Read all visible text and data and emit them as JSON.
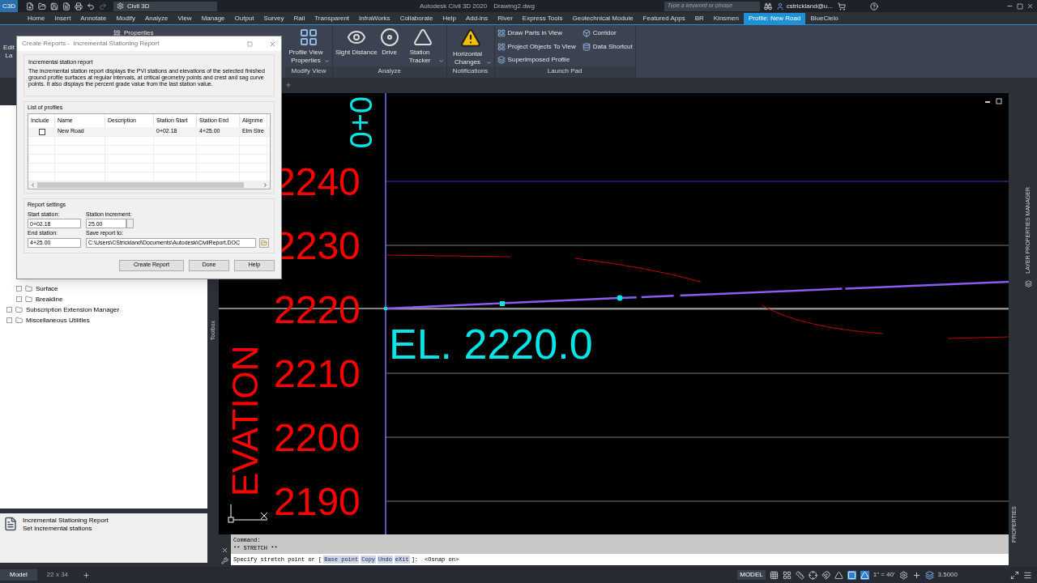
{
  "title_bar": {
    "logo_caption": "C3D",
    "workspace": "Civil 3D",
    "app_title": "Autodesk Civil 3D 2020",
    "file_name": "Drawing2.dwg",
    "search": {
      "placeholder": "Type a keyword or phrase"
    },
    "user": "cstrickland@u..."
  },
  "ribbon_tabs": [
    {
      "label": "Home",
      "selected": false
    },
    {
      "label": "Insert",
      "selected": false
    },
    {
      "label": "Annotate",
      "selected": false
    },
    {
      "label": "Modify",
      "selected": false
    },
    {
      "label": "Analyze",
      "selected": false
    },
    {
      "label": "View",
      "selected": false
    },
    {
      "label": "Manage",
      "selected": false
    },
    {
      "label": "Output",
      "selected": false
    },
    {
      "label": "Survey",
      "selected": false
    },
    {
      "label": "Rail",
      "selected": false
    },
    {
      "label": "Transparent",
      "selected": false
    },
    {
      "label": "InfraWorks",
      "selected": false
    },
    {
      "label": "Collaborate",
      "selected": false
    },
    {
      "label": "Help",
      "selected": false
    },
    {
      "label": "Add-ins",
      "selected": false
    },
    {
      "label": "River",
      "selected": false
    },
    {
      "label": "Express Tools",
      "selected": false
    },
    {
      "label": "Geotechnical Module",
      "selected": false
    },
    {
      "label": "Featured Apps",
      "selected": false
    },
    {
      "label": "BR",
      "selected": false
    },
    {
      "label": "Kinsmen",
      "selected": false
    },
    {
      "label": "Profile: New Road",
      "selected": true
    },
    {
      "label": "BlueCielo",
      "selected": false
    }
  ],
  "ribbon": {
    "partial_button": [
      "Edit",
      "La"
    ],
    "partial_small_button": "Properties",
    "groups": [
      {
        "title": "Modify View",
        "kind": "large",
        "buttons": [
          {
            "label": "Profile View Properties",
            "dropdown": true
          }
        ]
      },
      {
        "title": "Analyze",
        "kind": "large",
        "buttons": [
          {
            "label": "Sight Distance",
            "dropdown": false
          },
          {
            "label": "Drive",
            "dropdown": false
          },
          {
            "label": "Station Tracker",
            "dropdown": true
          }
        ]
      },
      {
        "title": "Notifications",
        "kind": "large",
        "buttons": [
          {
            "label": "Horizontal Changes",
            "dropdown": true
          }
        ]
      },
      {
        "title": "Launch Pad",
        "kind": "small",
        "buttons": [
          {
            "label": "Draw Parts in View"
          },
          {
            "label": "Project Objects To View"
          },
          {
            "label": "Superimposed Profile"
          },
          {
            "label": "Corridor"
          },
          {
            "label": "Data Shortcut"
          }
        ]
      }
    ]
  },
  "dialog": {
    "title": "Create Reports -  Incremental Stationing Report",
    "report_group": {
      "title": "Incremental station report",
      "description": "The incremental station report displays the PVI stations and elevations of the selected finished ground profile surfaces at regular intervals, at critical geometry points and crest and sag curve points. It also displays the percent grade value from the last station value."
    },
    "profiles": {
      "title": "List of profiles",
      "columns": [
        "Include",
        "Name",
        "Description",
        "Station Start",
        "Station End",
        "Alignme"
      ],
      "rows": [
        {
          "include": false,
          "name": "New Road",
          "description": "",
          "station_start": "0+02.18",
          "station_end": "4+25.00",
          "alignment": "Elm Stre"
        }
      ]
    },
    "settings": {
      "title": "Report settings",
      "start_station": {
        "label": "Start station:",
        "value": "0+02.18"
      },
      "station_increment": {
        "label": "Station increment:",
        "value": "25.00"
      },
      "end_station": {
        "label": "End station:",
        "value": "4+25.00"
      },
      "save_to": {
        "label": "Save report to:",
        "value": "C:\\Users\\CStrickland\\Documents\\Autodesk\\CivilReport.DOC"
      }
    },
    "buttons": [
      "Create Report",
      "Done",
      "Help"
    ]
  },
  "toolspace": {
    "tree": [
      {
        "children": [
          {
            "label": "Surface"
          },
          {
            "label": "Breakline"
          }
        ]
      },
      {
        "label": "Subscription Extension Manager"
      },
      {
        "label": "Miscellaneous Utilities"
      }
    ],
    "info": {
      "title": "Incremental Stationing Report",
      "subtitle": "Set incremental stations"
    },
    "side_tab": "Toolbox"
  },
  "canvas": {
    "elevation_labels": [
      "2240",
      "2230",
      "2220",
      "2210",
      "2200",
      "2190"
    ],
    "axis_title": "EVATION",
    "station_label": "0+0",
    "elevation_callout": "EL. 2220.0"
  },
  "command_line": {
    "history": [
      "Command:",
      "** STRETCH **"
    ],
    "prompt": "Specify stretch point or [",
    "options": [
      "Base point",
      "Copy",
      "Undo",
      "eXit"
    ],
    "prompt_end": "]:",
    "suffix": "<Osnap on>"
  },
  "layout_tabs": [
    {
      "label": "Model",
      "selected": true
    },
    {
      "label": "22 x 34",
      "selected": false
    }
  ],
  "status_bar": {
    "space": "MODEL",
    "scale": "1\" = 40'",
    "lineweight": "3.5000",
    "toggles": [
      {
        "on": false
      },
      {
        "on": false
      },
      {
        "on": false
      },
      {
        "on": false
      },
      {
        "on": false
      },
      {
        "on": false
      },
      {
        "on": true
      },
      {
        "on": true
      },
      {
        "on": false
      },
      {
        "on": false
      }
    ]
  },
  "palettes": [
    "LAYER PROPERTIES MANAGER",
    "PROPERTIES"
  ]
}
